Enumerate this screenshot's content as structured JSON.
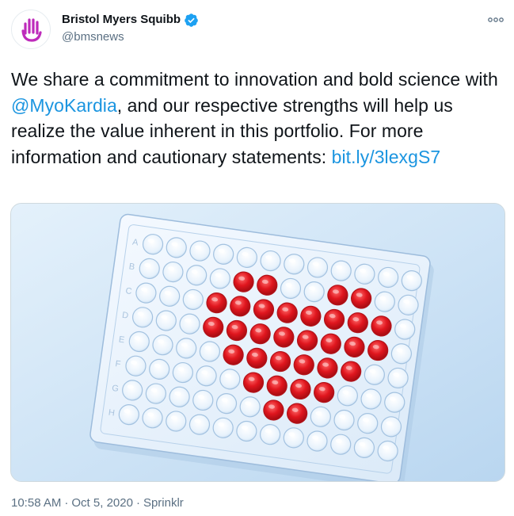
{
  "tweet": {
    "author": {
      "display_name": "Bristol Myers Squibb",
      "handle": "@bmsnews",
      "verified": true,
      "avatar_icon": "bms-hand-logo-icon",
      "brand_color": "#be2bbb"
    },
    "more_icon": "more-options-icon",
    "text": {
      "part1": "We share a commitment to innovation and bold science with ",
      "mention": "@MyoKardia",
      "part2": ", and our respective strengths will help us realize the value inherent in this portfolio. For more information and cautionary statements: ",
      "link": "bit.ly/3lexgS7"
    },
    "media": {
      "description_icon": "well-plate-heart-image",
      "row_letters": [
        "A",
        "B",
        "C",
        "D",
        "E",
        "F",
        "G",
        "H"
      ],
      "filled_color": "#d8141c",
      "background_color": "#cfe4f6"
    },
    "meta": {
      "time": "10:58 AM",
      "date": "Oct 5, 2020",
      "source": "Sprinklr"
    }
  }
}
